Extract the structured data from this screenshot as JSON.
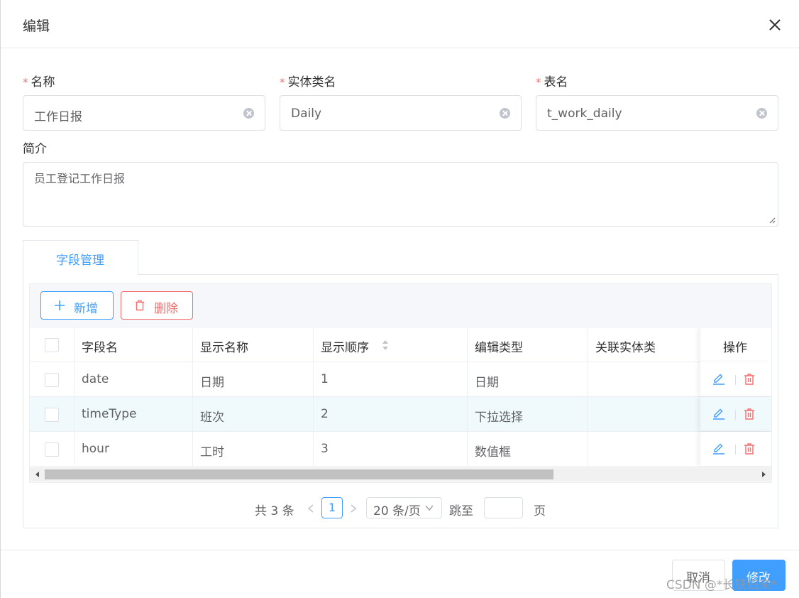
{
  "dialog": {
    "title": "编辑",
    "close_icon": "close-icon"
  },
  "form": {
    "required_mark": "*",
    "name": {
      "label": "名称",
      "value": "工作日报"
    },
    "entity_class": {
      "label": "实体类名",
      "value": "Daily"
    },
    "table_name": {
      "label": "表名",
      "value": "t_work_daily"
    },
    "description": {
      "label": "简介",
      "value": "员工登记工作日报"
    }
  },
  "tabs": [
    {
      "label": "字段管理",
      "active": true
    }
  ],
  "toolbar": {
    "add_label": "新增",
    "delete_label": "删除"
  },
  "table": {
    "columns": [
      "字段名",
      "显示名称",
      "显示顺序",
      "编辑类型",
      "关联实体类",
      "操作"
    ],
    "rows": [
      {
        "field": "date",
        "display": "日期",
        "order": "1",
        "edit_type": "日期",
        "entity": ""
      },
      {
        "field": "timeType",
        "display": "班次",
        "order": "2",
        "edit_type": "下拉选择",
        "entity": ""
      },
      {
        "field": "hour",
        "display": "工时",
        "order": "3",
        "edit_type": "数值框",
        "entity": ""
      }
    ]
  },
  "pagination": {
    "total_text": "共 3 条",
    "current_page": "1",
    "page_size": "20 条/页",
    "jump_label": "跳至",
    "page_suffix": "页"
  },
  "footer": {
    "cancel_label": "取消",
    "confirm_label": "修改"
  },
  "watermark": "CSDN @*长铗归来*",
  "colors": {
    "primary": "#409eff",
    "danger": "#f56c6c",
    "required": "#f56c6c",
    "row_highlight": "#f0f9fb"
  }
}
